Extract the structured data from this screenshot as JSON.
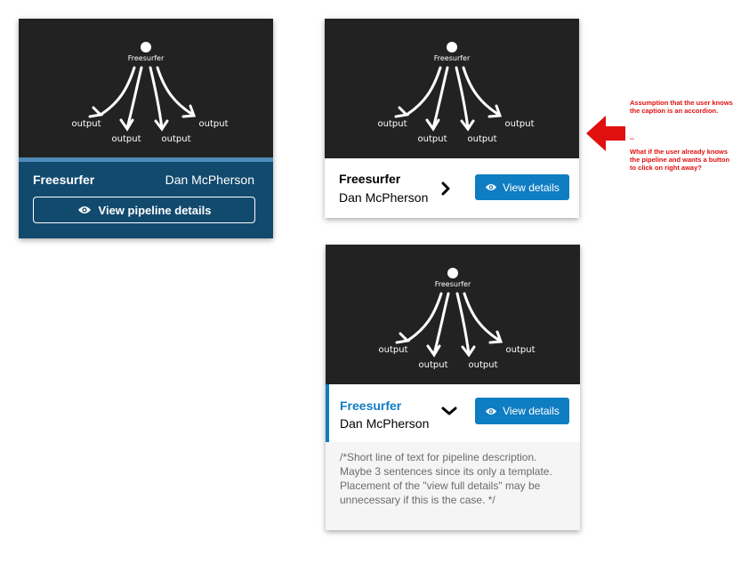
{
  "diagram": {
    "title": "Freesurfer",
    "outputs": [
      "output",
      "output",
      "output",
      "output"
    ]
  },
  "card_a": {
    "name": "Freesurfer",
    "author": "Dan McPherson",
    "button_label": "View pipeline details",
    "button_icon": "eye-icon"
  },
  "card_b": {
    "name": "Freesurfer",
    "author": "Dan McPherson",
    "toggle_icon": "chevron-right-icon",
    "button_label": "View details",
    "button_icon": "eye-icon"
  },
  "card_c": {
    "name": "Freesurfer",
    "author": "Dan McPherson",
    "toggle_icon": "chevron-down-icon",
    "button_label": "View details",
    "button_icon": "eye-icon",
    "description": "/*Short line of text for pipeline description. Maybe 3 sentences since its only a template. Placement of the \"view full details\" may be unnecessary if this is the case. */"
  },
  "annotation": {
    "arrow_icon": "left-arrow-icon",
    "line1": "Assumption that the user knows the caption is an accordion.",
    "separator": "--",
    "line2": "What if the user already knows the pipeline and wants a button to click on right away?"
  },
  "colors": {
    "diagram_bg": "#222222",
    "card_a_bg": "#124a6e",
    "accent_blue": "#0f7dc2",
    "annotation_red": "#e01010"
  }
}
